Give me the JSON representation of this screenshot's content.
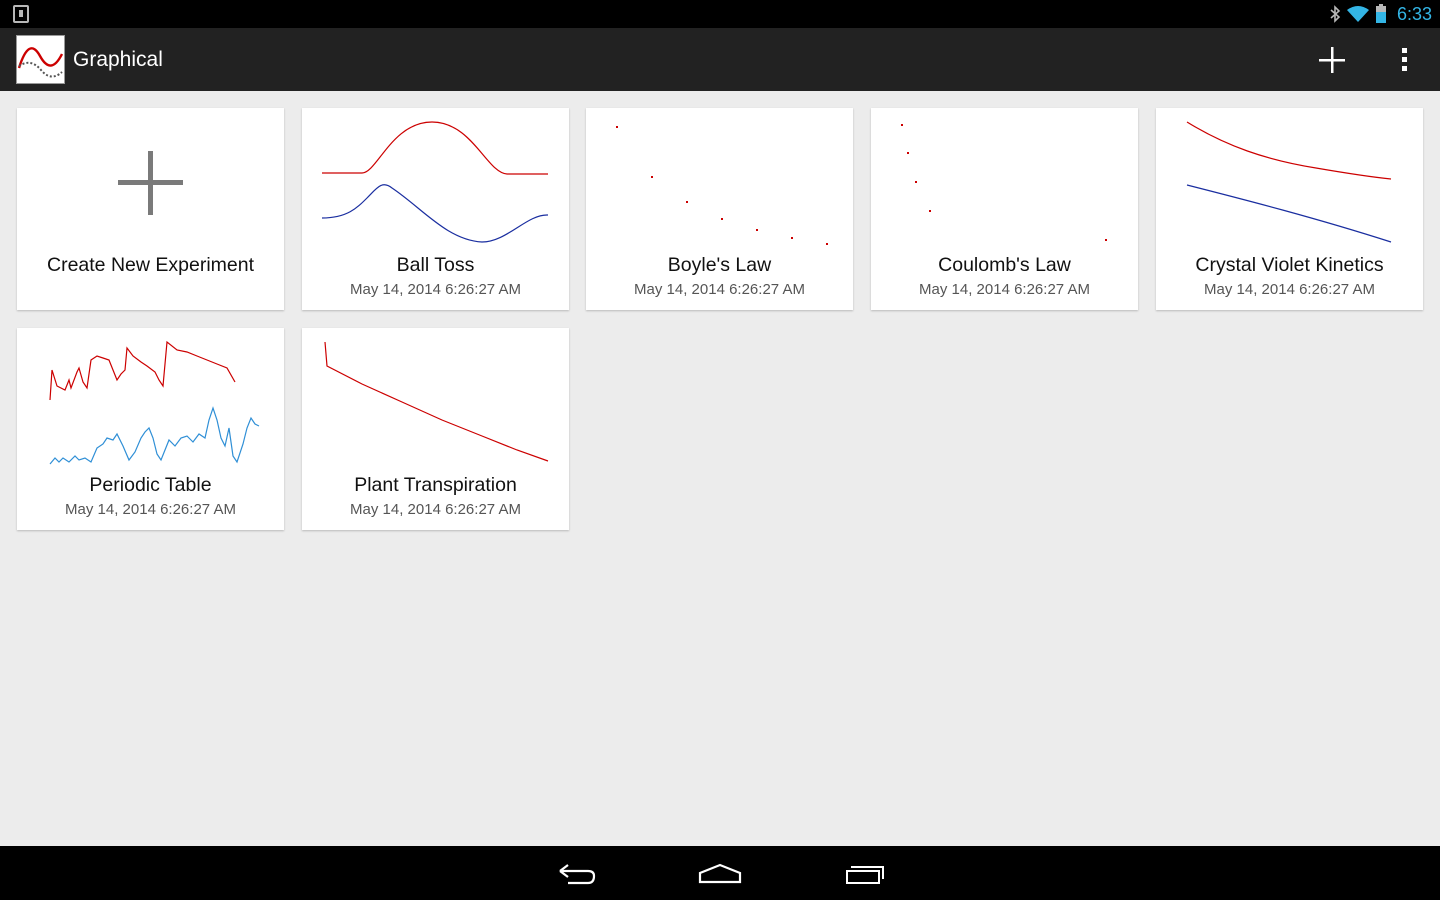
{
  "status": {
    "time": "6:33",
    "accent": "#33b5e5"
  },
  "app": {
    "title": "Graphical",
    "logo_icon": "sine-graph-icon",
    "bar_color": "#222222"
  },
  "actions": {
    "add_icon": "plus-icon",
    "overflow_icon": "overflow-menu-icon"
  },
  "create_card": {
    "title": "Create New Experiment",
    "icon": "plus-icon"
  },
  "experiments": [
    {
      "title": "Ball Toss",
      "date": "May 14, 2014 6:26:27 AM"
    },
    {
      "title": "Boyle's Law",
      "date": "May 14, 2014 6:26:27 AM"
    },
    {
      "title": "Coulomb's Law",
      "date": "May 14, 2014 6:26:27 AM"
    },
    {
      "title": "Crystal Violet Kinetics",
      "date": "May 14, 2014 6:26:27 AM"
    },
    {
      "title": "Periodic Table",
      "date": "May 14, 2014 6:26:27 AM"
    },
    {
      "title": "Plant Transpiration",
      "date": "May 14, 2014 6:26:27 AM"
    }
  ],
  "colors": {
    "series_red": "#cc0000",
    "series_blue": "#1a2ea0",
    "series_lightblue": "#2f8fd6"
  },
  "nav": {
    "back_icon": "back-icon",
    "home_icon": "home-icon",
    "recents_icon": "recent-apps-icon"
  }
}
